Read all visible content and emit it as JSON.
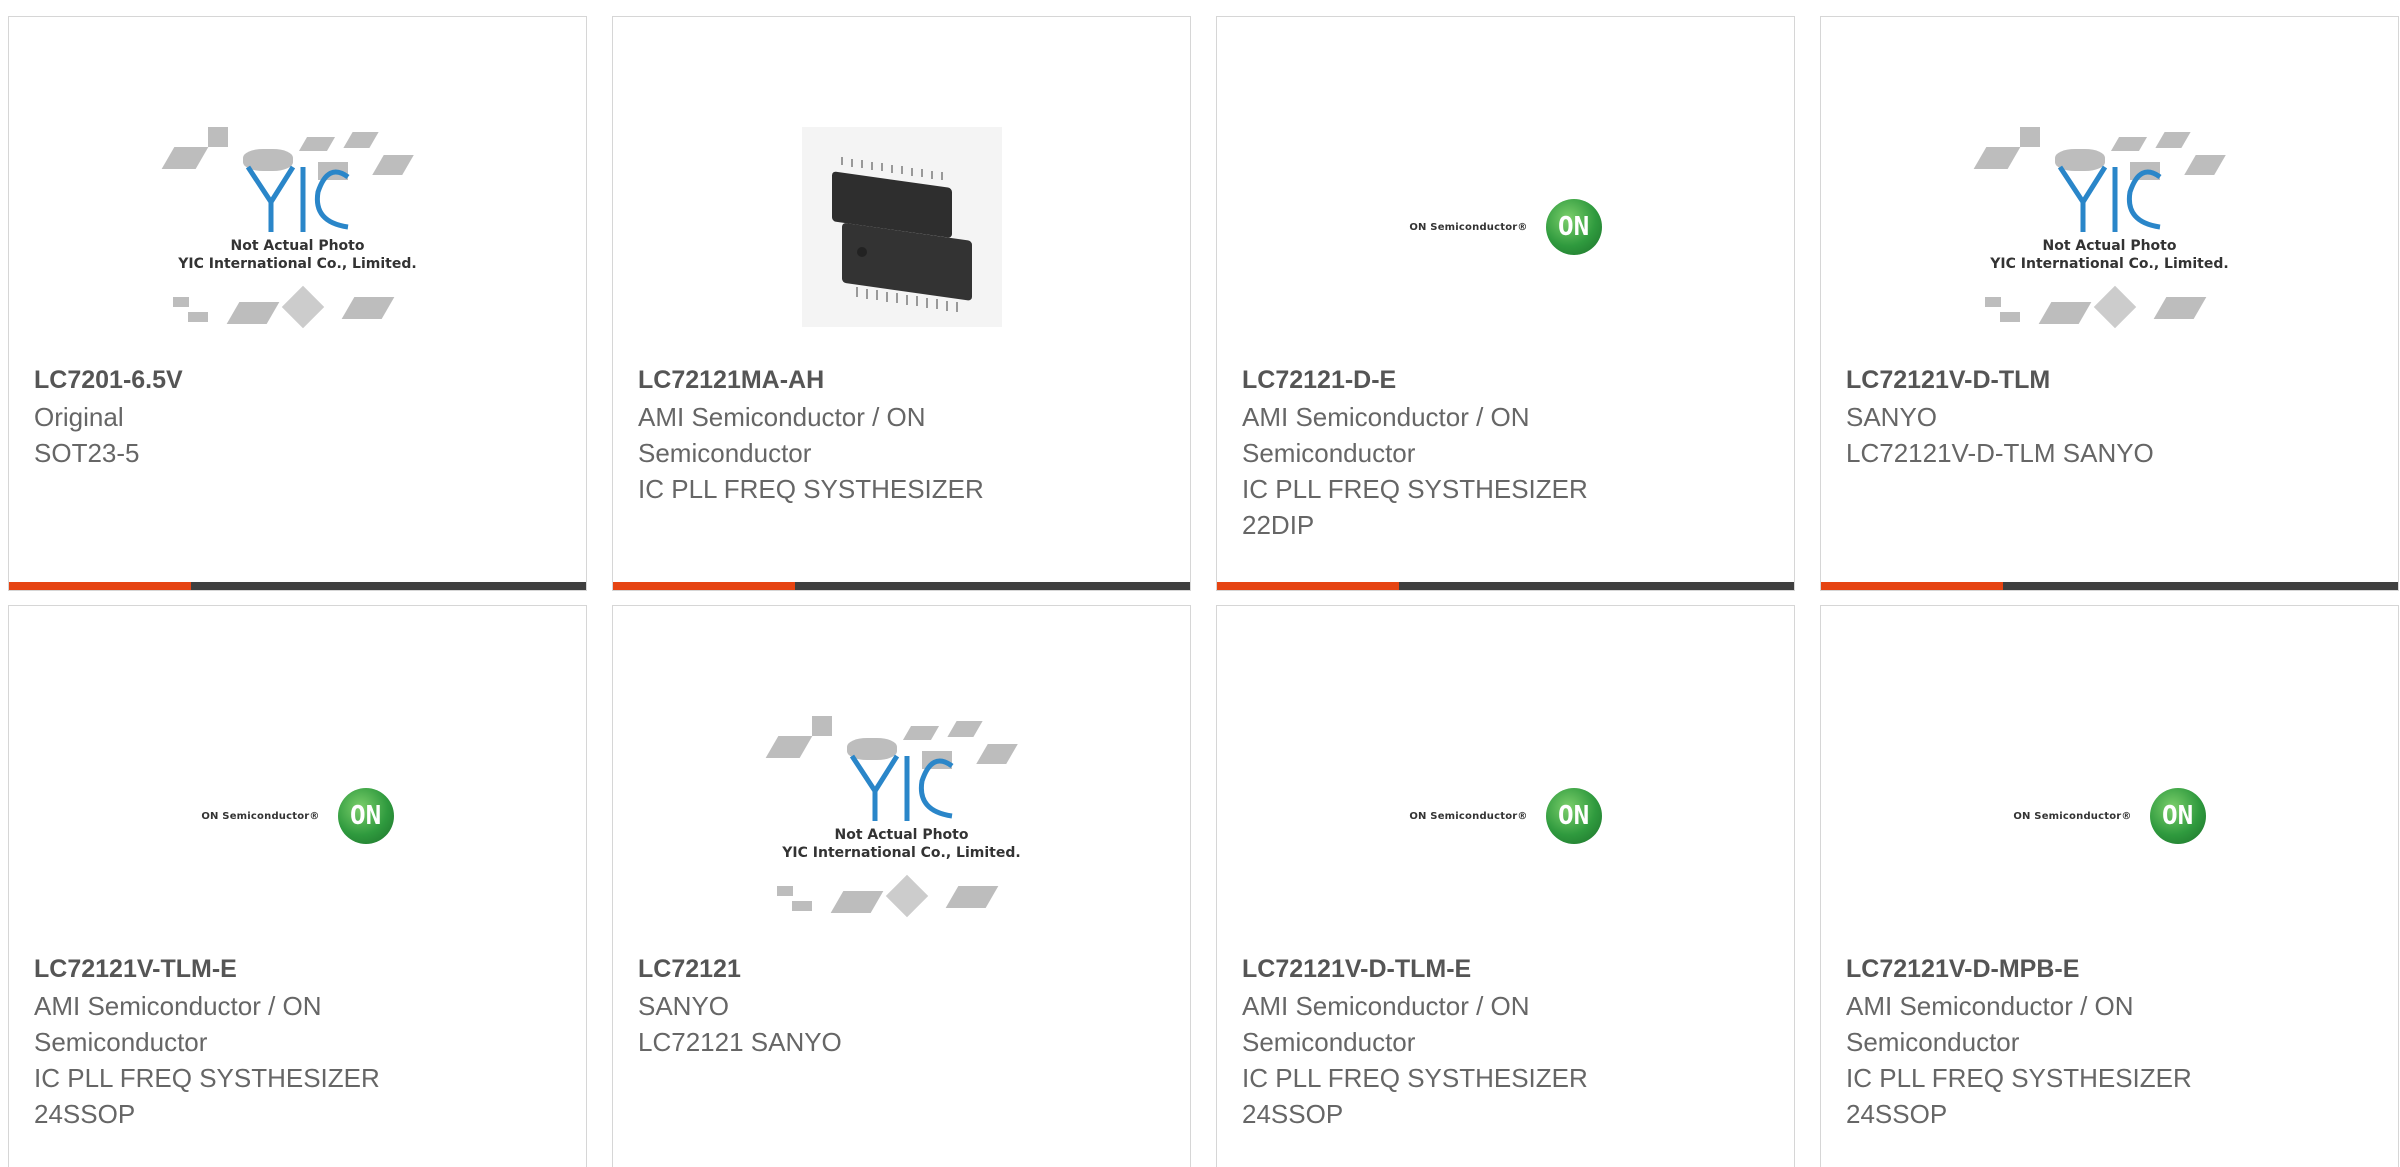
{
  "cards": [
    {
      "part_number": "LC7201-6.5V",
      "lines": [
        "Original",
        "SOT23-5"
      ],
      "image": "yic-placeholder"
    },
    {
      "part_number": "LC72121MA-AH",
      "lines": [
        "AMI Semiconductor / ON",
        "Semiconductor",
        "IC PLL FREQ SYSTHESIZER"
      ],
      "image": "chip-photo"
    },
    {
      "part_number": "LC72121-D-E",
      "lines": [
        "AMI Semiconductor / ON",
        "Semiconductor",
        "IC PLL FREQ SYSTHESIZER",
        "22DIP"
      ],
      "image": "on-semiconductor-logo"
    },
    {
      "part_number": "LC72121V-D-TLM",
      "lines": [
        "SANYO",
        "LC72121V-D-TLM SANYO"
      ],
      "image": "yic-placeholder"
    },
    {
      "part_number": "LC72121V-TLM-E",
      "lines": [
        "AMI Semiconductor / ON",
        "Semiconductor",
        "IC PLL FREQ SYSTHESIZER",
        "24SSOP"
      ],
      "image": "on-semiconductor-logo"
    },
    {
      "part_number": "LC72121",
      "lines": [
        "SANYO",
        "LC72121 SANYO"
      ],
      "image": "yic-placeholder"
    },
    {
      "part_number": "LC72121V-D-TLM-E",
      "lines": [
        "AMI Semiconductor / ON",
        "Semiconductor",
        "IC PLL FREQ SYSTHESIZER",
        "24SSOP"
      ],
      "image": "on-semiconductor-logo"
    },
    {
      "part_number": "LC72121V-D-MPB-E",
      "lines": [
        "AMI Semiconductor / ON",
        "Semiconductor",
        "IC PLL FREQ SYSTHESIZER",
        "24SSOP"
      ],
      "image": "on-semiconductor-logo"
    }
  ],
  "yic_caption": [
    "Not Actual Photo",
    "YIC International Co., Limited."
  ],
  "on_logo_text": "ON Semiconductor®",
  "on_logo_mark": "ON",
  "colors": {
    "accent": "#e64412",
    "bar": "#3f3f3f",
    "on_green": "#2f9a3e"
  }
}
